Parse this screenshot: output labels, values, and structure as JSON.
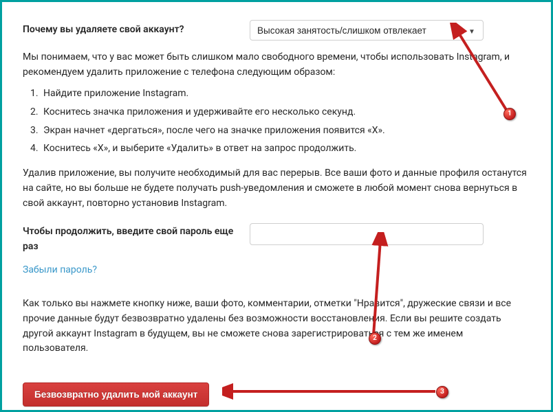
{
  "question_label": "Почему вы удаляете свой аккаунт?",
  "reason_selected": "Высокая занятость/слишком отвлекает",
  "intro_text": "Мы понимаем, что у вас может быть слишком мало свободного времени, чтобы использовать Instagram, и рекомендуем удалить приложение с телефона следующим образом:",
  "steps": [
    "Найдите приложение Instagram.",
    "Коснитесь значка приложения и удерживайте его несколько секунд.",
    "Экран начнет «дергаться», после чего на значке приложения появится «X».",
    "Коснитесь «X», и выберите «Удалить» в ответ на запрос продолжить."
  ],
  "after_steps_text": "Удалив приложение, вы получите необходимый для вас перерыв. Все ваши фото и данные профиля останутся на сайте, но вы больше не будете получать push-уведомления и сможете в любой момент снова вернуться в свой аккаунт, повторно установив Instagram.",
  "password_label": "Чтобы продолжить, введите свой пароль еще раз",
  "forgot_label": "Забыли пароль?",
  "warning_text": "Как только вы нажмете кнопку ниже, ваши фото, комментарии, отметки \"Нравится\", дружеские связи и все прочие данные будут безвозвратно удалены без возможности восстановления. Если вы решите создать другой аккаунт Instagram в будущем, вы не сможете снова зарегистрироваться с тем же именем пользователя.",
  "delete_button_label": "Безвозвратно удалить мой аккаунт",
  "annotations": {
    "1": "1",
    "2": "2",
    "3": "3"
  }
}
